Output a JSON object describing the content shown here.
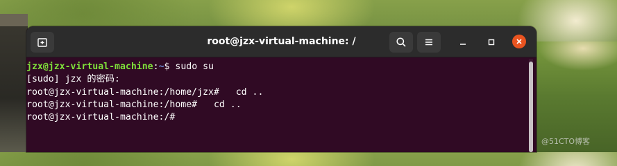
{
  "window": {
    "title": "root@jzx-virtual-machine: /"
  },
  "terminal": {
    "lines": [
      {
        "user": "jzx@jzx-virtual-machine",
        "sep": ":",
        "path": "~",
        "text": "$ sudo su"
      },
      {
        "text": "[sudo] jzx 的密码:"
      },
      {
        "text": "root@jzx-virtual-machine:/home/jzx#   cd .."
      },
      {
        "text": "root@jzx-virtual-machine:/home#   cd .."
      },
      {
        "text": "root@jzx-virtual-machine:/#"
      }
    ]
  },
  "watermark": "@51CTO博客",
  "icons": {
    "new_tab": "new-tab-icon",
    "search": "search-icon",
    "menu": "hamburger-menu-icon",
    "minimize": "minimize-icon",
    "maximize": "maximize-icon",
    "close": "close-icon"
  },
  "colors": {
    "terminal_bg": "#300a24",
    "titlebar_bg": "#2c2c2c",
    "user_green": "#7fe03a",
    "path_blue": "#6e8fdb",
    "close_orange": "#e95420"
  }
}
